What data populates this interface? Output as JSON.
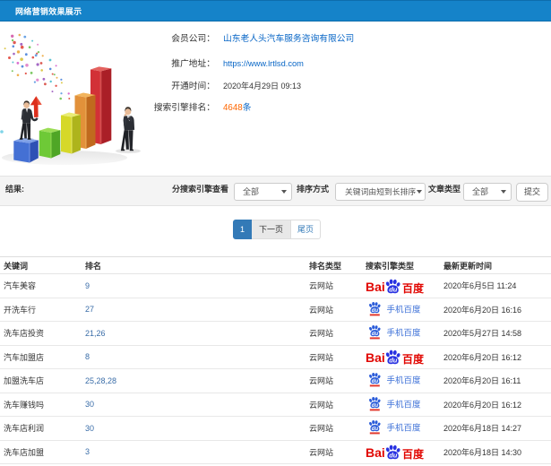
{
  "header": {
    "title": "网络营销效果展示",
    "bg_color": "#1583c9"
  },
  "info": {
    "rows": [
      {
        "label": "会员公司：",
        "value": "山东老人头汽车服务咨询有限公司"
      },
      {
        "label": "推广地址：",
        "value": "https://www.lrtlsd.com"
      },
      {
        "label": "开通时间：",
        "value": "2020年4月29日 09:13"
      },
      {
        "label": "搜索引擎排名：",
        "value_number": "4648",
        "value_unit": "条"
      }
    ]
  },
  "filters": {
    "result_label": "结果:",
    "engine_label": "分搜索引擎查看",
    "engine_value": "全部",
    "sort_label": "排序方式",
    "sort_value": "关键词由短到长排序",
    "article_label": "文章类型",
    "article_value": "全部",
    "submit_label": "提交"
  },
  "pagination": {
    "current": "1",
    "next": "下一页",
    "last": "尾页",
    "active_color": "#337ab7"
  },
  "table": {
    "headers": [
      "关键词",
      "排名",
      "排名类型",
      "搜索引擎类型",
      "最新更新时间"
    ],
    "rows": [
      {
        "keyword": "汽车美容",
        "rank": "9",
        "rank_type": "云网站",
        "engine": "baidu",
        "time": "2020年6月5日 11:24"
      },
      {
        "keyword": "开洗车行",
        "rank": "27",
        "rank_type": "云网站",
        "engine": "mobile-baidu",
        "time": "2020年6月20日 16:16"
      },
      {
        "keyword": "洗车店投资",
        "rank": "21,26",
        "rank_type": "云网站",
        "engine": "mobile-baidu",
        "time": "2020年5月27日 14:58"
      },
      {
        "keyword": "汽车加盟店",
        "rank": "8",
        "rank_type": "云网站",
        "engine": "baidu",
        "time": "2020年6月20日 16:12"
      },
      {
        "keyword": "加盟洗车店",
        "rank": "25,28,28",
        "rank_type": "云网站",
        "engine": "mobile-baidu",
        "time": "2020年6月20日 16:11"
      },
      {
        "keyword": "洗车赚钱吗",
        "rank": "30",
        "rank_type": "云网站",
        "engine": "mobile-baidu",
        "time": "2020年6月20日 16:12"
      },
      {
        "keyword": "洗车店利润",
        "rank": "30",
        "rank_type": "云网站",
        "engine": "mobile-baidu",
        "time": "2020年6月18日 14:27"
      },
      {
        "keyword": "洗车店加盟",
        "rank": "3",
        "rank_type": "云网站",
        "engine": "baidu",
        "time": "2020年6月18日 14:30"
      }
    ],
    "baidu_logo": {
      "bai": "Bai",
      "du": "du",
      "cn": "百度"
    },
    "mobile_logo": {
      "du": "du",
      "text": "手机百度"
    }
  },
  "colors": {
    "link_blue": "#0866c6",
    "rank_blue": "#3a6da8",
    "count_orange": "#ff6600",
    "baidu_red": "#e10601",
    "baidu_blue": "#2932e1",
    "mobile_blue": "#3f72d8"
  }
}
